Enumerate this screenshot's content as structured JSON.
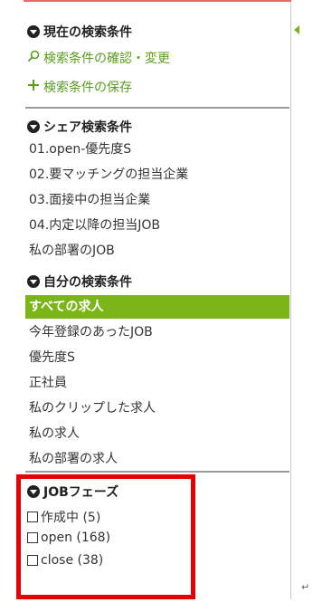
{
  "current": {
    "title": "現在の検索条件",
    "confirm_label": "検索条件の確認・変更",
    "save_label": "検索条件の保存"
  },
  "shared": {
    "title": "シェア検索条件",
    "items": [
      {
        "label": "01.open-優先度S"
      },
      {
        "label": "02.要マッチングの担当企業"
      },
      {
        "label": "03.面接中の担当企業"
      },
      {
        "label": "04.内定以降の担当JOB"
      },
      {
        "label": "私の部署のJOB"
      }
    ]
  },
  "mine": {
    "title": "自分の検索条件",
    "items": [
      {
        "label": "すべての求人",
        "active": true
      },
      {
        "label": "今年登録のあったJOB"
      },
      {
        "label": "優先度S"
      },
      {
        "label": "正社員"
      },
      {
        "label": "私のクリップした求人"
      },
      {
        "label": "私の求人"
      },
      {
        "label": "私の部署の求人"
      }
    ]
  },
  "job_phase": {
    "title": "JOBフェーズ",
    "options": [
      {
        "label": "作成中 (5)",
        "checked": false
      },
      {
        "label": "open (168)",
        "checked": false
      },
      {
        "label": "close (38)",
        "checked": false
      }
    ]
  },
  "colors": {
    "accent": "#7cb518",
    "highlight": "#e60000",
    "top_line": "#e86a6a"
  },
  "icons": {
    "confirm": "search-icon",
    "save": "plus-icon",
    "section": "circle-chevron-down-icon",
    "collapse": "triangle-left-icon"
  }
}
